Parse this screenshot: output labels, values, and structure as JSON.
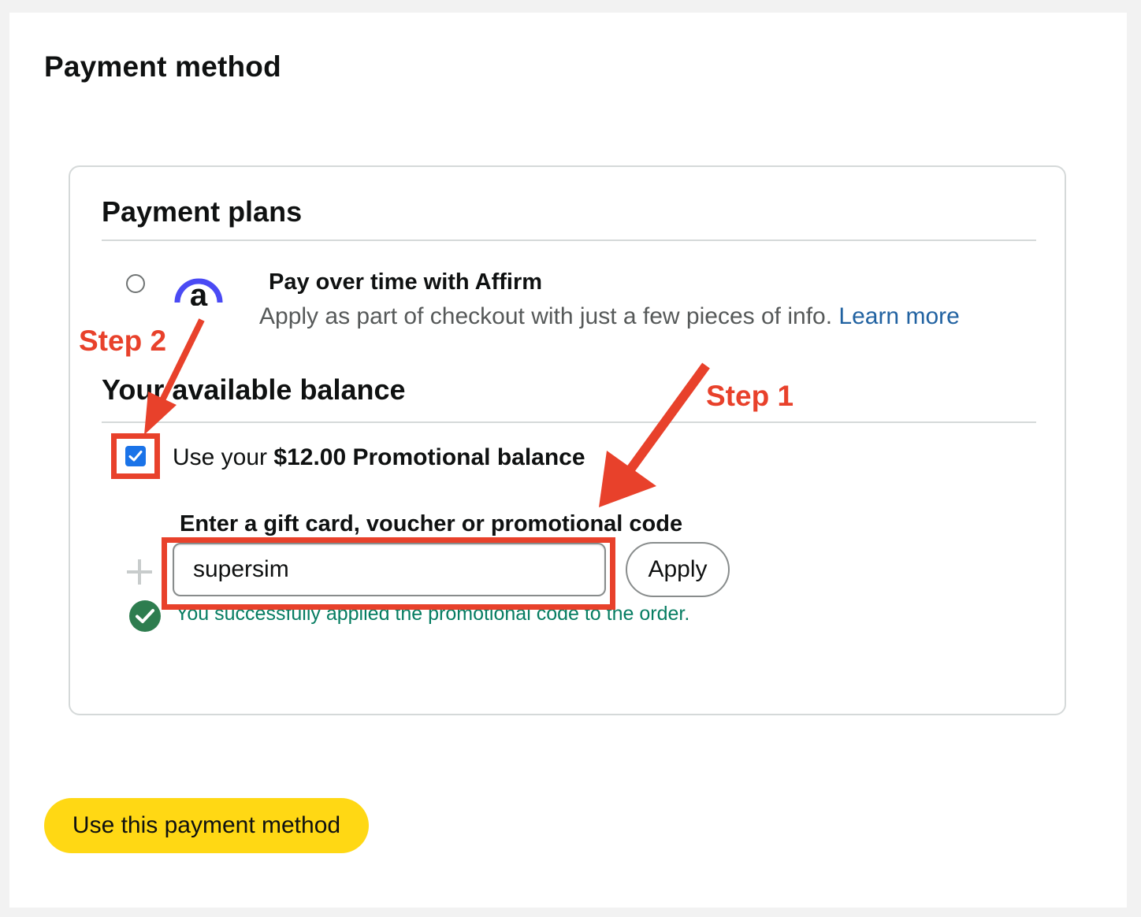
{
  "page": {
    "title": "Payment method"
  },
  "payment_plans": {
    "title": "Payment plans",
    "affirm": {
      "logo_letter": "a",
      "title": "Pay over time with Affirm",
      "description": "Apply as part of checkout with just a few pieces of info. ",
      "link": "Learn more"
    }
  },
  "balance": {
    "title": "Your available balance",
    "checked": true,
    "label_prefix": "Use your ",
    "label_bold": "$12.00 Promotional balance"
  },
  "code": {
    "label": "Enter a gift card, voucher or promotional code",
    "value": "supersim",
    "apply_label": "Apply",
    "success_message": "You successfully applied the promotional code to the order."
  },
  "footer": {
    "submit_label": "Use this payment method"
  },
  "annotations": {
    "step1": "Step 1",
    "step2": "Step 2",
    "color": "#e8412b"
  },
  "colors": {
    "button_yellow": "#ffd814",
    "link_blue": "#2162a1",
    "success_green": "#067d62",
    "checkbox_blue": "#1a73e8",
    "affirm_blue": "#4a4af4"
  },
  "icons": [
    "radio-circle",
    "affirm-logo",
    "checkbox-checked",
    "plus-icon",
    "check-circle-icon",
    "arrow-annotation"
  ]
}
